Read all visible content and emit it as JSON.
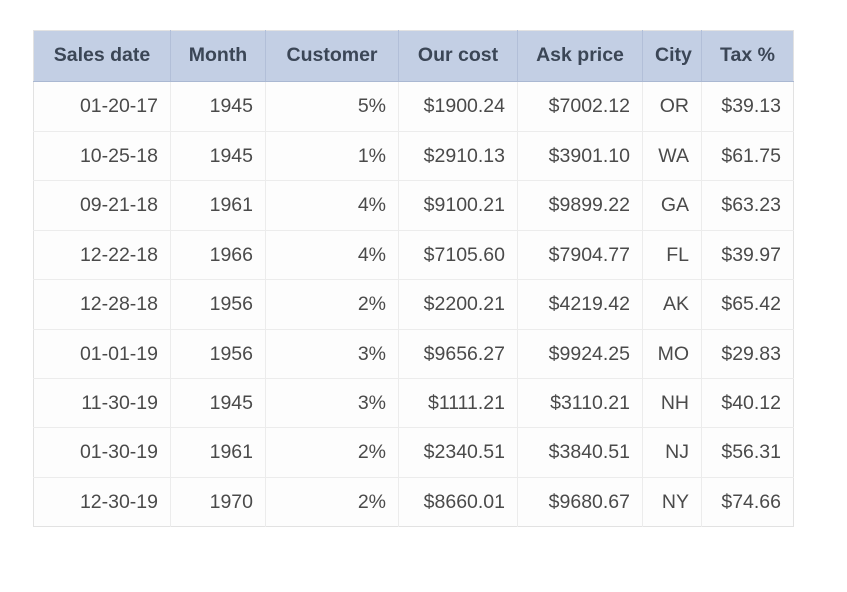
{
  "table": {
    "columns": [
      {
        "key": "sales_date",
        "label": "Sales date"
      },
      {
        "key": "month",
        "label": "Month"
      },
      {
        "key": "customer",
        "label": "Customer"
      },
      {
        "key": "our_cost",
        "label": "Our cost"
      },
      {
        "key": "ask_price",
        "label": "Ask price"
      },
      {
        "key": "city",
        "label": "City"
      },
      {
        "key": "tax_pct",
        "label": "Tax %"
      }
    ],
    "rows": [
      {
        "sales_date": "01-20-17",
        "month": "1945",
        "customer": "5%",
        "our_cost": "$1900.24",
        "ask_price": "$7002.12",
        "city": "OR",
        "tax_pct": "$39.13"
      },
      {
        "sales_date": "10-25-18",
        "month": "1945",
        "customer": "1%",
        "our_cost": "$2910.13",
        "ask_price": "$3901.10",
        "city": "WA",
        "tax_pct": "$61.75"
      },
      {
        "sales_date": "09-21-18",
        "month": "1961",
        "customer": "4%",
        "our_cost": "$9100.21",
        "ask_price": "$9899.22",
        "city": "GA",
        "tax_pct": "$63.23"
      },
      {
        "sales_date": "12-22-18",
        "month": "1966",
        "customer": "4%",
        "our_cost": "$7105.60",
        "ask_price": "$7904.77",
        "city": "FL",
        "tax_pct": "$39.97"
      },
      {
        "sales_date": "12-28-18",
        "month": "1956",
        "customer": "2%",
        "our_cost": "$2200.21",
        "ask_price": "$4219.42",
        "city": "AK",
        "tax_pct": "$65.42"
      },
      {
        "sales_date": "01-01-19",
        "month": "1956",
        "customer": "3%",
        "our_cost": "$9656.27",
        "ask_price": "$9924.25",
        "city": "MO",
        "tax_pct": "$29.83"
      },
      {
        "sales_date": "11-30-19",
        "month": "1945",
        "customer": "3%",
        "our_cost": "$1111.21",
        "ask_price": "$3110.21",
        "city": "NH",
        "tax_pct": "$40.12"
      },
      {
        "sales_date": "01-30-19",
        "month": "1961",
        "customer": "2%",
        "our_cost": "$2340.51",
        "ask_price": "$3840.51",
        "city": "NJ",
        "tax_pct": "$56.31"
      },
      {
        "sales_date": "12-30-19",
        "month": "1970",
        "customer": "2%",
        "our_cost": "$8660.01",
        "ask_price": "$9680.67",
        "city": "NY",
        "tax_pct": "$74.66"
      }
    ]
  },
  "style": {
    "header_bg": "#c3cfe4",
    "header_text": "#3b4656",
    "cell_text": "#4a4a4a",
    "row_border": "#ececec",
    "page_bg": "#ffffff"
  }
}
